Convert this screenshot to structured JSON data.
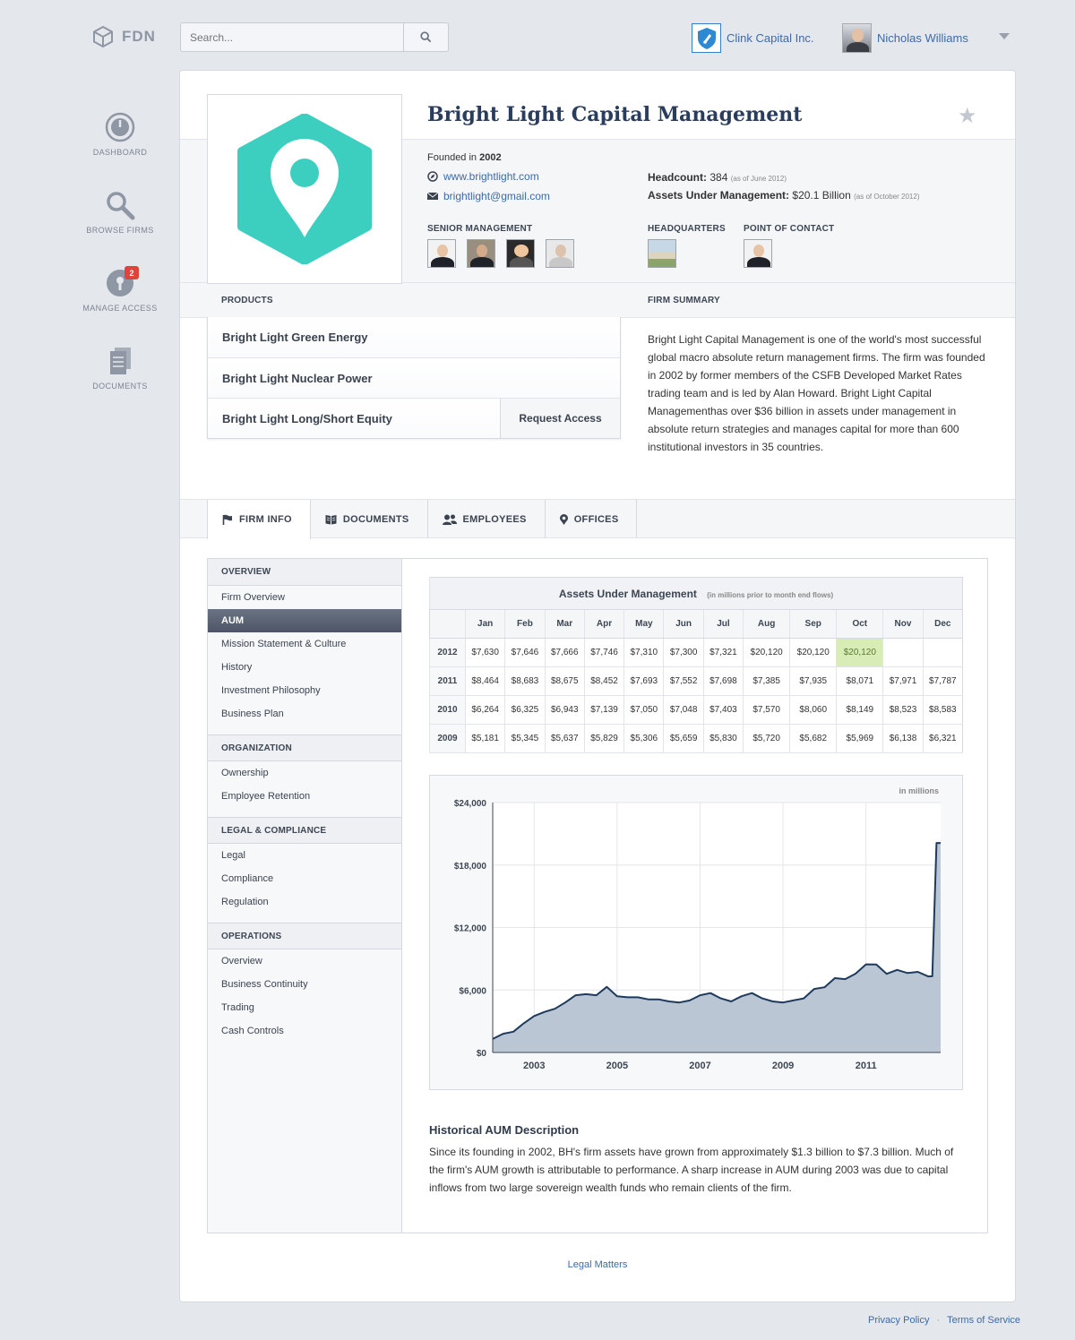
{
  "brand": {
    "logo_text": "FDN"
  },
  "search": {
    "placeholder": "Search..."
  },
  "account": {
    "company": "Clink Capital Inc.",
    "user": "Nicholas Williams"
  },
  "nav": [
    {
      "label": "DASHBOARD",
      "icon": "dashboard-gauge-icon"
    },
    {
      "label": "BROWSE FIRMS",
      "icon": "search-icon"
    },
    {
      "label": "MANAGE ACCESS",
      "icon": "keyhole-lock-icon",
      "badge": "2"
    },
    {
      "label": "DOCUMENTS",
      "icon": "document-icon"
    }
  ],
  "firm": {
    "name": "Bright Light Capital Management",
    "founded_label": "Founded in",
    "founded_year": "2002",
    "website": "www.brightlight.com",
    "email": "brightlight@gmail.com",
    "headcount_label": "Headcount:",
    "headcount_value": "384",
    "headcount_note": "(as of June 2012)",
    "aum_label": "Assets Under Management:",
    "aum_value": "$20.1 Billion",
    "aum_note": "(as of October 2012)",
    "senior_management_label": "SENIOR MANAGEMENT",
    "headquarters_label": "HEADQUARTERS",
    "point_of_contact_label": "POINT OF CONTACT",
    "brand_color": "#3ccfc0"
  },
  "products": {
    "heading": "PRODUCTS",
    "items": [
      "Bright Light Green Energy",
      "Bright Light Nuclear Power",
      "Bright Light Long/Short Equity"
    ],
    "request_access": "Request Access"
  },
  "summary": {
    "heading": "FIRM SUMMARY",
    "text": "Bright Light Capital Management is one of the world's most successful global macro absolute return management firms. The firm was founded in 2002 by former members of the CSFB Developed Market Rates trading team and is led by Alan Howard. Bright Light Capital Managementhas over $36 billion in assets under management in absolute return strategies and manages capital for more than 600 institutional investors in 35 countries."
  },
  "tabs": [
    {
      "label": "FIRM INFO",
      "icon": "flag-icon"
    },
    {
      "label": "DOCUMENTS",
      "icon": "book-icon"
    },
    {
      "label": "EMPLOYEES",
      "icon": "people-icon"
    },
    {
      "label": "OFFICES",
      "icon": "map-pin-icon"
    }
  ],
  "leftnav": {
    "overview": {
      "heading": "OVERVIEW",
      "items": [
        "Firm Overview",
        "AUM",
        "Mission Statement & Culture",
        "History",
        "Investment Philosophy",
        "Business Plan"
      ]
    },
    "organization": {
      "heading": "ORGANIZATION",
      "items": [
        "Ownership",
        "Employee Retention"
      ]
    },
    "legal": {
      "heading": "LEGAL & COMPLIANCE",
      "items": [
        "Legal",
        "Compliance",
        "Regulation"
      ]
    },
    "operations": {
      "heading": "OPERATIONS",
      "items": [
        "Overview",
        "Business Continuity",
        "Trading",
        "Cash Controls"
      ]
    }
  },
  "aum_table": {
    "title": "Assets Under Management",
    "note": "(in millions prior to month end flows)",
    "months": [
      "Jan",
      "Feb",
      "Mar",
      "Apr",
      "May",
      "Jun",
      "Jul",
      "Aug",
      "Sep",
      "Oct",
      "Nov",
      "Dec"
    ],
    "rows": [
      {
        "year": "2012",
        "values": [
          "$7,630",
          "$7,646",
          "$7,666",
          "$7,746",
          "$7,310",
          "$7,300",
          "$7,321",
          "$20,120",
          "$20,120",
          "$20,120",
          "",
          ""
        ]
      },
      {
        "year": "2011",
        "values": [
          "$8,464",
          "$8,683",
          "$8,675",
          "$8,452",
          "$7,693",
          "$7,552",
          "$7,698",
          "$7,385",
          "$7,935",
          "$8,071",
          "$7,971",
          "$7,787"
        ]
      },
      {
        "year": "2010",
        "values": [
          "$6,264",
          "$6,325",
          "$6,943",
          "$7,139",
          "$7,050",
          "$7,048",
          "$7,403",
          "$7,570",
          "$8,060",
          "$8,149",
          "$8,523",
          "$8,583"
        ]
      },
      {
        "year": "2009",
        "values": [
          "$5,181",
          "$5,345",
          "$5,637",
          "$5,829",
          "$5,306",
          "$5,659",
          "$5,830",
          "$5,720",
          "$5,682",
          "$5,969",
          "$6,138",
          "$6,321"
        ]
      }
    ],
    "highlight_color": "#d8ecb8"
  },
  "chart_data": {
    "type": "area",
    "note": "in millions",
    "ylim": [
      0,
      24000
    ],
    "yticks": [
      "$0",
      "$6,000",
      "$12,000",
      "$18,000",
      "$24,000"
    ],
    "ytick_values": [
      0,
      6000,
      12000,
      18000,
      24000
    ],
    "xlim": [
      2002,
      2012.8
    ],
    "xticks": [
      "2003",
      "2005",
      "2007",
      "2009",
      "2011"
    ],
    "xtick_values": [
      2003,
      2005,
      2007,
      2009,
      2011
    ],
    "x": [
      2002.0,
      2002.25,
      2002.5,
      2002.75,
      2003.0,
      2003.25,
      2003.5,
      2003.75,
      2004.0,
      2004.25,
      2004.5,
      2004.75,
      2005.0,
      2005.25,
      2005.5,
      2005.75,
      2006.0,
      2006.25,
      2006.5,
      2006.75,
      2007.0,
      2007.25,
      2007.5,
      2007.75,
      2008.0,
      2008.25,
      2008.5,
      2008.75,
      2009.0,
      2009.25,
      2009.5,
      2009.75,
      2010.0,
      2010.25,
      2010.5,
      2010.75,
      2011.0,
      2011.25,
      2011.5,
      2011.75,
      2012.0,
      2012.25,
      2012.5,
      2012.6,
      2012.7,
      2012.8
    ],
    "values": [
      1300,
      1800,
      2000,
      2800,
      3500,
      3900,
      4200,
      4800,
      5500,
      5600,
      5500,
      6300,
      5400,
      5300,
      5300,
      5100,
      5100,
      4900,
      4800,
      5000,
      5500,
      5700,
      5200,
      4900,
      5400,
      5700,
      5200,
      4900,
      4800,
      5000,
      5200,
      6100,
      6264,
      7139,
      7048,
      7570,
      8464,
      8452,
      7552,
      7935,
      7630,
      7746,
      7300,
      7321,
      20120,
      20120
    ],
    "line_color": "#1e3a5c",
    "fill_color": "#b6c3d2"
  },
  "history": {
    "title": "Historical AUM Description",
    "text": "Since its founding in 2002, BH's firm assets have grown from approximately $1.3 billion to $7.3 billion. Much of the firm's AUM growth is attributable to performance. A sharp increase in AUM during 2003 was due to capital inflows from two large sovereign wealth funds who remain clients of the firm."
  },
  "legal_link": "Legal Matters",
  "footer": {
    "privacy": "Privacy Policy",
    "terms": "Terms of Service",
    "separator": "·"
  }
}
